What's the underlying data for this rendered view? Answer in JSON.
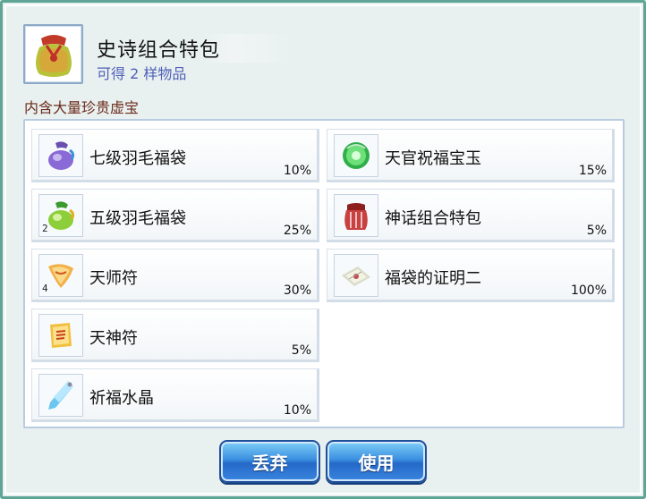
{
  "header": {
    "title": "史诗组合特包",
    "subtitle": "可得 2 样物品",
    "note": "内含大量珍贵虚宝",
    "icon": "red-bag-icon"
  },
  "items": [
    {
      "name": "七级羽毛福袋",
      "pct": "10%",
      "qty": "",
      "icon": "purple-bag-icon"
    },
    {
      "name": "天官祝福宝玉",
      "pct": "15%",
      "qty": "",
      "icon": "green-orb-icon"
    },
    {
      "name": "五级羽毛福袋",
      "pct": "25%",
      "qty": "2",
      "icon": "green-bag-icon"
    },
    {
      "name": "神话组合特包",
      "pct": "5%",
      "qty": "",
      "icon": "red-pack-icon"
    },
    {
      "name": "天师符",
      "pct": "30%",
      "qty": "4",
      "icon": "talisman-icon"
    },
    {
      "name": "福袋的证明二",
      "pct": "100%",
      "qty": "",
      "icon": "certificate-icon"
    },
    {
      "name": "天神符",
      "pct": "5%",
      "qty": "",
      "icon": "scroll-icon"
    },
    {
      "name": "祈福水晶",
      "pct": "10%",
      "qty": "",
      "icon": "crystal-icon"
    }
  ],
  "buttons": {
    "discard": "丢弃",
    "use": "使用"
  }
}
